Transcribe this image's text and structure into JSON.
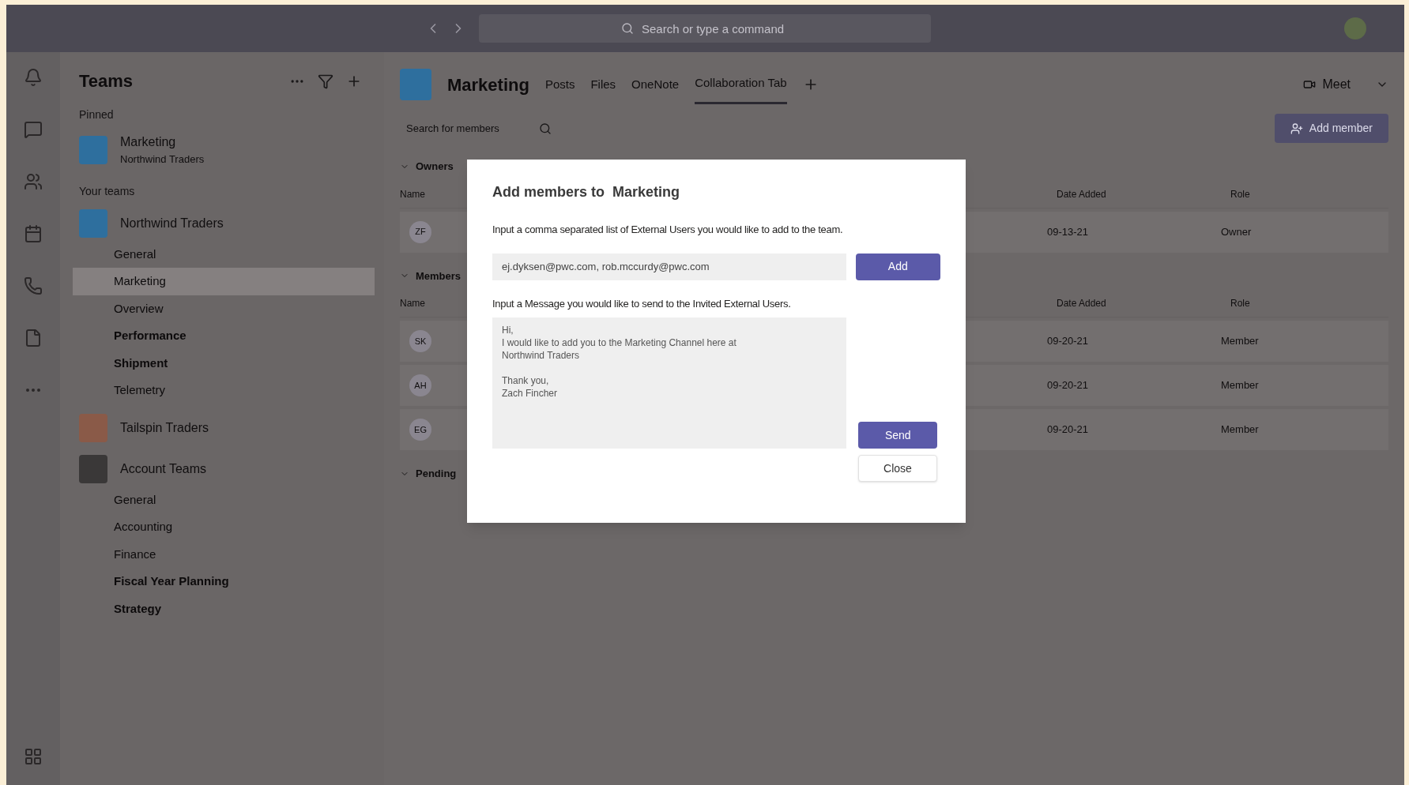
{
  "title_bar": {
    "search": {
      "placeholder": "Search or type a command"
    }
  },
  "rail": {
    "items": [
      {
        "kind": "bell"
      },
      {
        "kind": "chat"
      },
      {
        "kind": "teams"
      },
      {
        "kind": "calendar"
      },
      {
        "kind": "phone"
      },
      {
        "kind": "file"
      },
      {
        "kind": "more"
      }
    ],
    "apps": {
      "kind": "apps"
    }
  },
  "sidebar": {
    "title": "Teams",
    "sections": [
      {
        "heading": "Pinned",
        "teams": [
          {
            "name": "Marketing",
            "subtitle": "Northwind Traders",
            "color": "#2e6f9e"
          }
        ]
      },
      {
        "heading": "Your teams",
        "teams": [
          {
            "name": "Northwind Traders",
            "color": "#2e6f9e",
            "channels": [
              {
                "name": "General",
                "bold": false,
                "selected": false
              },
              {
                "name": "Marketing",
                "bold": false,
                "selected": true
              },
              {
                "name": "Overview",
                "bold": false,
                "selected": false
              },
              {
                "name": "Performance",
                "bold": true,
                "selected": false
              },
              {
                "name": "Shipment",
                "bold": true,
                "selected": false
              },
              {
                "name": "Telemetry",
                "bold": false,
                "selected": false
              }
            ]
          },
          {
            "name": "Tailspin Traders",
            "color": "#8a5a48"
          },
          {
            "name": "Account Teams",
            "color": "#3a3838",
            "channels": [
              {
                "name": "General",
                "bold": false,
                "selected": false
              },
              {
                "name": "Accounting",
                "bold": false,
                "selected": false
              },
              {
                "name": "Finance",
                "bold": false,
                "selected": false
              },
              {
                "name": "Fiscal Year Planning",
                "bold": true,
                "selected": false
              },
              {
                "name": "Strategy",
                "bold": true,
                "selected": false
              }
            ]
          }
        ]
      }
    ]
  },
  "header": {
    "title": "Marketing",
    "tabs": [
      {
        "label": "Posts",
        "selected": false
      },
      {
        "label": "Files",
        "selected": false
      },
      {
        "label": "OneNote",
        "selected": false
      },
      {
        "label": "Collaboration Tab",
        "selected": true
      }
    ],
    "meet": "Meet"
  },
  "members": {
    "search": {
      "placeholder": "Search for members"
    },
    "add_button": "Add member",
    "groups": [
      {
        "title": "Owners",
        "columns": [
          "Name",
          "Date Added",
          "Role"
        ],
        "rows": [
          {
            "initials": "ZF",
            "date": "09-13-21",
            "role": "Owner"
          }
        ]
      },
      {
        "title": "Members",
        "columns": [
          "Name",
          "Date Added",
          "Role"
        ],
        "rows": [
          {
            "initials": "SK",
            "date": "09-20-21",
            "role": "Member"
          },
          {
            "initials": "AH",
            "date": "09-20-21",
            "role": "Member"
          },
          {
            "initials": "EG",
            "date": "09-20-21",
            "role": "Member"
          }
        ]
      },
      {
        "title": "Pending"
      }
    ]
  },
  "dialog": {
    "title": "Add members to  Marketing",
    "emails_label": "Input a comma separated list of External Users you would like to add to the team.",
    "emails_value": "ej.dyksen@pwc.com, rob.mccurdy@pwc.com",
    "add": "Add",
    "message_label": "Input a Message you would like to send to the Invited External Users.",
    "message_value": "Hi,\nI would like to add you to the Marketing Channel here at\nNorthwind Traders\n\nThank you,\nZach Fincher",
    "send": "Send",
    "close": "Close"
  }
}
